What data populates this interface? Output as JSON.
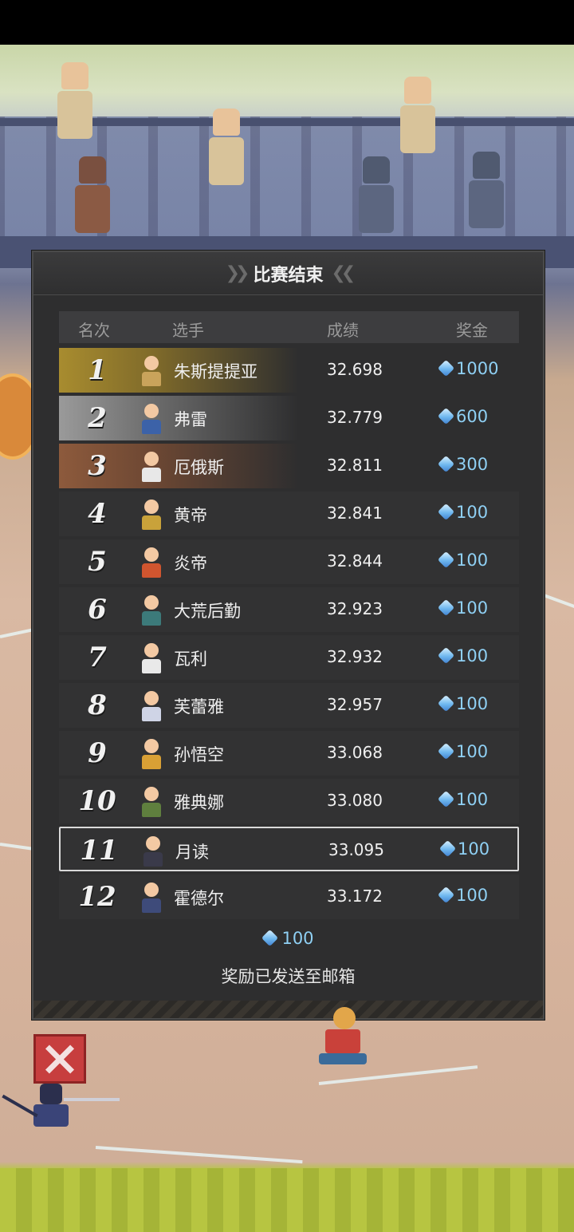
{
  "panel": {
    "title": "比赛结束",
    "columns": {
      "rank": "名次",
      "player": "选手",
      "score": "成绩",
      "prize": "奖金"
    },
    "rows": [
      {
        "rank": "1",
        "name": "朱斯提提亚",
        "score": "32.698",
        "prize": "1000",
        "color": "#c9a35b"
      },
      {
        "rank": "2",
        "name": "弗雷",
        "score": "32.779",
        "prize": "600",
        "color": "#3c62a8"
      },
      {
        "rank": "3",
        "name": "厄俄斯",
        "score": "32.811",
        "prize": "300",
        "color": "#e8e8e8"
      },
      {
        "rank": "4",
        "name": "黄帝",
        "score": "32.841",
        "prize": "100",
        "color": "#c9a23a"
      },
      {
        "rank": "5",
        "name": "炎帝",
        "score": "32.844",
        "prize": "100",
        "color": "#d0552f"
      },
      {
        "rank": "6",
        "name": "大荒后勤",
        "score": "32.923",
        "prize": "100",
        "color": "#3c7a7a"
      },
      {
        "rank": "7",
        "name": "瓦利",
        "score": "32.932",
        "prize": "100",
        "color": "#e9e9e9"
      },
      {
        "rank": "8",
        "name": "芙蕾雅",
        "score": "32.957",
        "prize": "100",
        "color": "#cfd4e6"
      },
      {
        "rank": "9",
        "name": "孙悟空",
        "score": "33.068",
        "prize": "100",
        "color": "#d9a035"
      },
      {
        "rank": "10",
        "name": "雅典娜",
        "score": "33.080",
        "prize": "100",
        "color": "#5f7f3e"
      },
      {
        "rank": "11",
        "name": "月读",
        "score": "33.095",
        "prize": "100",
        "color": "#3a3a4a"
      },
      {
        "rank": "12",
        "name": "霍德尔",
        "score": "33.172",
        "prize": "100",
        "color": "#3e4b7a"
      }
    ],
    "highlight_rank": "11",
    "reward_amount": "100",
    "reward_message": "奖励已发送至邮箱"
  },
  "colors": {
    "gold": "#a88c2f",
    "silver": "#9a9a9a",
    "bronze": "#8d5a3c",
    "gem": "#8fd0f4",
    "close": "#c73e3e"
  },
  "icons": [
    "gem-icon",
    "close-icon"
  ]
}
